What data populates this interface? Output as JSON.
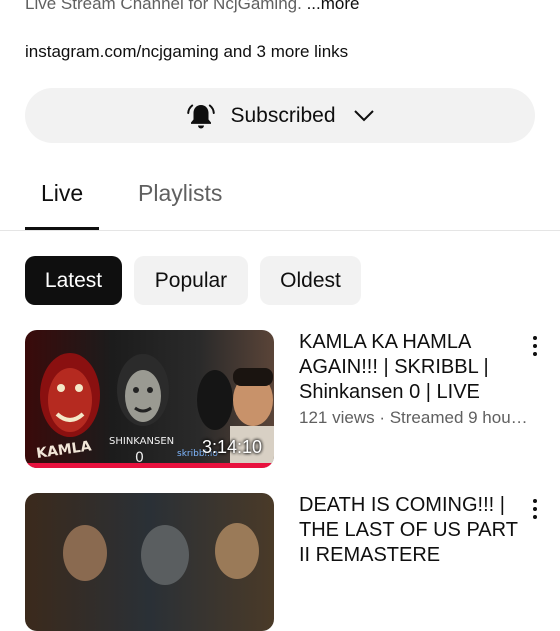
{
  "channel": {
    "description": "Live Stream Channel for NcjGaming.",
    "more_label": "...more",
    "links_text": "instagram.com/ncjgaming",
    "links_extra": "and 3 more links",
    "subscribe_label": "Subscribed"
  },
  "tabs": [
    {
      "label": "Live",
      "selected": true
    },
    {
      "label": "Playlists",
      "selected": false
    }
  ],
  "chips": [
    {
      "label": "Latest",
      "selected": true
    },
    {
      "label": "Popular",
      "selected": false
    },
    {
      "label": "Oldest",
      "selected": false
    }
  ],
  "videos": [
    {
      "title": "KAMLA KA HAMLA AGAIN!!! | SKRIBBL | Shinkansen 0 | LIVE",
      "meta": "121 views · Streamed 9 hou…",
      "duration": "3:14:10",
      "watch_progress": 1.0,
      "thumb_texts": [
        "KAMLA",
        "SHINKANSEN",
        "0",
        "skribbl.io"
      ]
    },
    {
      "title": "DEATH IS COMING!!! | THE LAST OF US PART II REMASTERE",
      "meta": "",
      "duration": "",
      "watch_progress": 0,
      "thumb_texts": []
    }
  ],
  "colors": {
    "accent_red": "#e8113e",
    "chip_selected": "#0f0f0f",
    "chip_bg": "#f2f2f2",
    "secondary_text": "#606060"
  },
  "icons": {
    "bell": "notifications-active-icon",
    "chevron": "chevron-down-icon",
    "more": "more-vert-icon"
  }
}
